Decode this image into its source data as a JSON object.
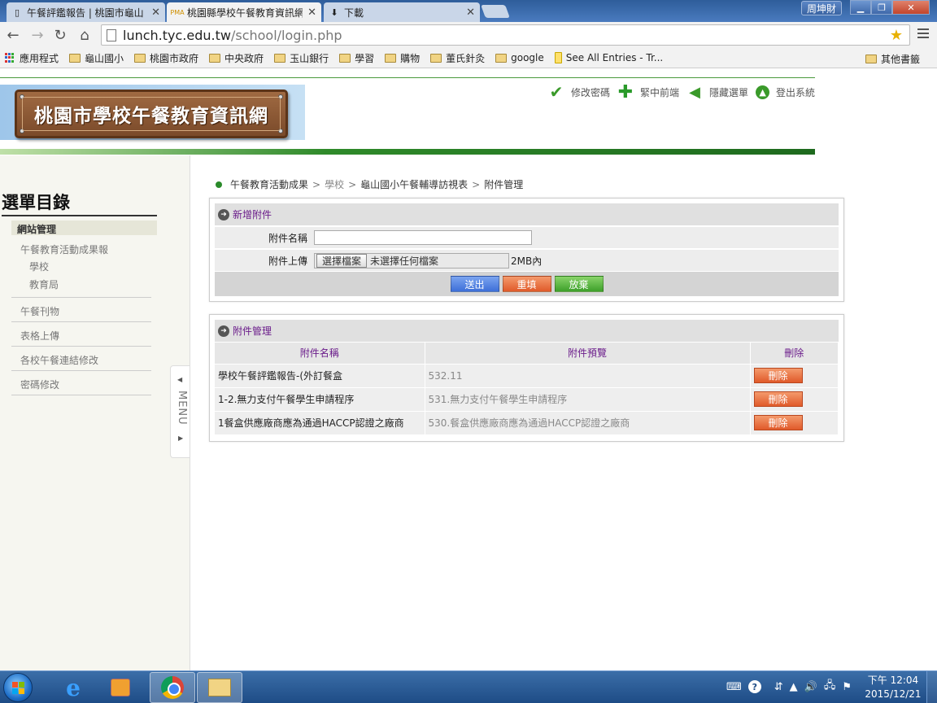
{
  "browser": {
    "tabs": [
      {
        "title": "午餐評鑑報告 | 桃園市龜山",
        "active": false,
        "icon": "page-icon"
      },
      {
        "title": "桃園縣學校午餐教育資訊網",
        "active": true,
        "icon": "pma-icon",
        "icon_text": "PMA"
      },
      {
        "title": "下載",
        "active": false,
        "icon": "download-icon"
      }
    ],
    "user": "周坤財",
    "url_host": "lunch.tyc.edu.tw",
    "url_path": "/school/login.php",
    "bookmarks": [
      "應用程式",
      "龜山國小",
      "桃園市政府",
      "中央政府",
      "玉山銀行",
      "學習",
      "購物",
      "董氏針灸",
      "google",
      "See All Entries - Tr..."
    ],
    "other_bookmarks": "其他書籤"
  },
  "site": {
    "title": "桃園市學校午餐教育資訊網",
    "top_links": [
      "修改密碼",
      "緊中前端",
      "隱藏選單",
      "登出系統"
    ]
  },
  "sidebar": {
    "title": "選單目錄",
    "section": "網站管理",
    "item_report": "午餐教育活動成果報",
    "sub_school": "學校",
    "sub_bureau": "教育局",
    "item_magazine": "午餐刊物",
    "item_upload": "表格上傳",
    "item_links": "各校午餐連結修改",
    "item_password": "密碼修改",
    "menu_tab": "MENU"
  },
  "breadcrumb": {
    "home": "午餐教育活動成果",
    "school": "學校",
    "visit": "龜山國小午餐輔導訪視表",
    "current": "附件管理",
    "sep": ">"
  },
  "add_form": {
    "heading": "新增附件",
    "name_label": "附件名稱",
    "upload_label": "附件上傳",
    "file_button": "選擇檔案",
    "file_status": "未選擇任何檔案",
    "size_note": "2MB內",
    "submit": "送出",
    "reset": "重填",
    "cancel": "放棄"
  },
  "attachments": {
    "heading": "附件管理",
    "col_name": "附件名稱",
    "col_preview": "附件預覽",
    "col_delete": "刪除",
    "delete_label": "刪除",
    "rows": [
      {
        "name": "學校午餐評鑑報告-(外訂餐盒",
        "preview": "532.11"
      },
      {
        "name": "1-2.無力支付午餐學生申請程序",
        "preview": "531.無力支付午餐學生申請程序"
      },
      {
        "name": "1餐盒供應廠商應為通過HACCP認證之廠商",
        "preview": "530.餐盒供應廠商應為通過HACCP認證之廠商"
      }
    ]
  },
  "taskbar": {
    "time": "下午 12:04",
    "date": "2015/12/21"
  }
}
